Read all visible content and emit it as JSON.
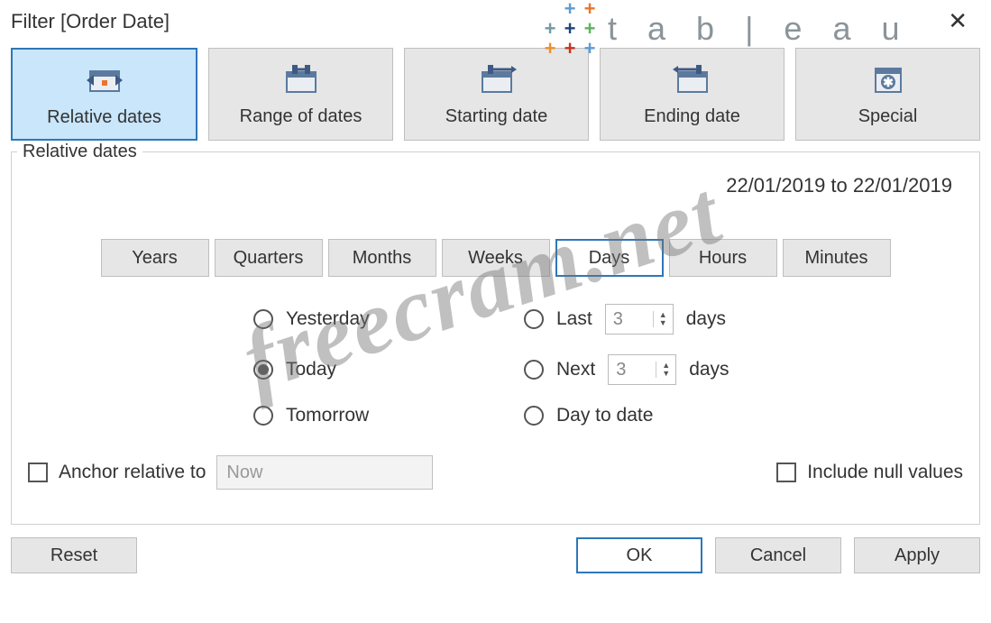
{
  "title": "Filter [Order Date]",
  "logo_text": "t a b | e a u",
  "tabs": [
    {
      "label": "Relative dates",
      "selected": true
    },
    {
      "label": "Range of dates",
      "selected": false
    },
    {
      "label": "Starting date",
      "selected": false
    },
    {
      "label": "Ending date",
      "selected": false
    },
    {
      "label": "Special",
      "selected": false
    }
  ],
  "frame_title": "Relative dates",
  "date_range_display": "22/01/2019 to 22/01/2019",
  "units": [
    {
      "label": "Years",
      "selected": false
    },
    {
      "label": "Quarters",
      "selected": false
    },
    {
      "label": "Months",
      "selected": false
    },
    {
      "label": "Weeks",
      "selected": false
    },
    {
      "label": "Days",
      "selected": true
    },
    {
      "label": "Hours",
      "selected": false
    },
    {
      "label": "Minutes",
      "selected": false
    }
  ],
  "options": {
    "yesterday": {
      "label": "Yesterday",
      "checked": false
    },
    "today": {
      "label": "Today",
      "checked": true
    },
    "tomorrow": {
      "label": "Tomorrow",
      "checked": false
    },
    "last": {
      "label": "Last",
      "value": "3",
      "suffix": "days",
      "checked": false
    },
    "next": {
      "label": "Next",
      "value": "3",
      "suffix": "days",
      "checked": false
    },
    "daytodate": {
      "label": "Day to date",
      "checked": false
    }
  },
  "anchor": {
    "label": "Anchor relative to",
    "checked": false,
    "placeholder": "Now"
  },
  "include_null": {
    "label": "Include null values",
    "checked": false
  },
  "buttons": {
    "reset": "Reset",
    "ok": "OK",
    "cancel": "Cancel",
    "apply": "Apply"
  },
  "watermark": "freecram.net"
}
